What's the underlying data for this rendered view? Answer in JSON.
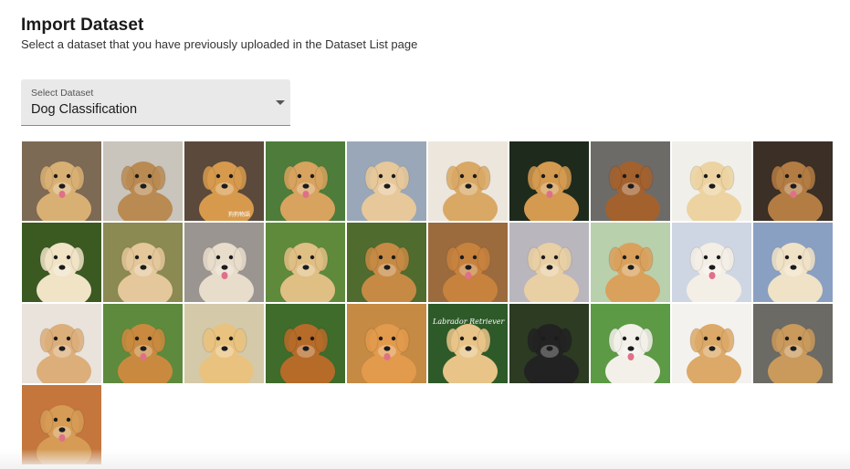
{
  "header": {
    "title": "Import Dataset",
    "subtitle": "Select a dataset that you have previously uploaded in the Dataset List page"
  },
  "dataset_select": {
    "label": "Select Dataset",
    "value": "Dog Classification",
    "icon": "chevron-down-icon"
  },
  "gallery": {
    "images": [
      {
        "bg": "#7d6a55",
        "fur": "#d9b074"
      },
      {
        "bg": "#c9c4bc",
        "fur": "#b98a52"
      },
      {
        "bg": "#5b4a3c",
        "fur": "#d79a4d"
      },
      {
        "bg": "#4e7c3a",
        "fur": "#d7a35e"
      },
      {
        "bg": "#9aa7b8",
        "fur": "#e6c89a"
      },
      {
        "bg": "#ece6dc",
        "fur": "#d9a865"
      },
      {
        "bg": "#1e2a1c",
        "fur": "#d39a50"
      },
      {
        "bg": "#6d6b68",
        "fur": "#a3612e"
      },
      {
        "bg": "#f1efea",
        "fur": "#ecd3a1"
      },
      {
        "bg": "#3b2f26",
        "fur": "#b37c43"
      },
      {
        "bg": "#3a5a22",
        "fur": "#f0e3c6"
      },
      {
        "bg": "#8a8a52",
        "fur": "#e4c79a"
      },
      {
        "bg": "#9a9590",
        "fur": "#e8dccb"
      },
      {
        "bg": "#5f8a3b",
        "fur": "#e0bf84"
      },
      {
        "bg": "#4f6b2e",
        "fur": "#c68a45"
      },
      {
        "bg": "#9b6b3e",
        "fur": "#c7823e"
      },
      {
        "bg": "#b9b6bd",
        "fur": "#e9cfa4"
      },
      {
        "bg": "#b9d0ad",
        "fur": "#d9a15c"
      },
      {
        "bg": "#cfd6e3",
        "fur": "#f4efe6"
      },
      {
        "bg": "#8aa0c3",
        "fur": "#f0e2c7"
      },
      {
        "bg": "#e9e3dc",
        "fur": "#dcae7a"
      },
      {
        "bg": "#5e8a3d",
        "fur": "#c98a3f"
      },
      {
        "bg": "#d4c9a8",
        "fur": "#e9c27f"
      },
      {
        "bg": "#3f6b2b",
        "fur": "#b66b29"
      },
      {
        "bg": "#c58a43",
        "fur": "#e29a4d"
      },
      {
        "bg": "#2e5a2a",
        "fur": "#e8c488"
      },
      {
        "bg": "#2c3b22",
        "fur": "#222222"
      },
      {
        "bg": "#5d9a45",
        "fur": "#f3f0ea"
      },
      {
        "bg": "#f4f2ef",
        "fur": "#dca968"
      },
      {
        "bg": "#6c6a64",
        "fur": "#c99a5c"
      },
      {
        "bg": "#c4763c",
        "fur": "#d69b55"
      }
    ]
  },
  "tile_overlay_text": {
    "tile_2": "狗狗物語",
    "tile_25": "Labrador Retriever"
  }
}
